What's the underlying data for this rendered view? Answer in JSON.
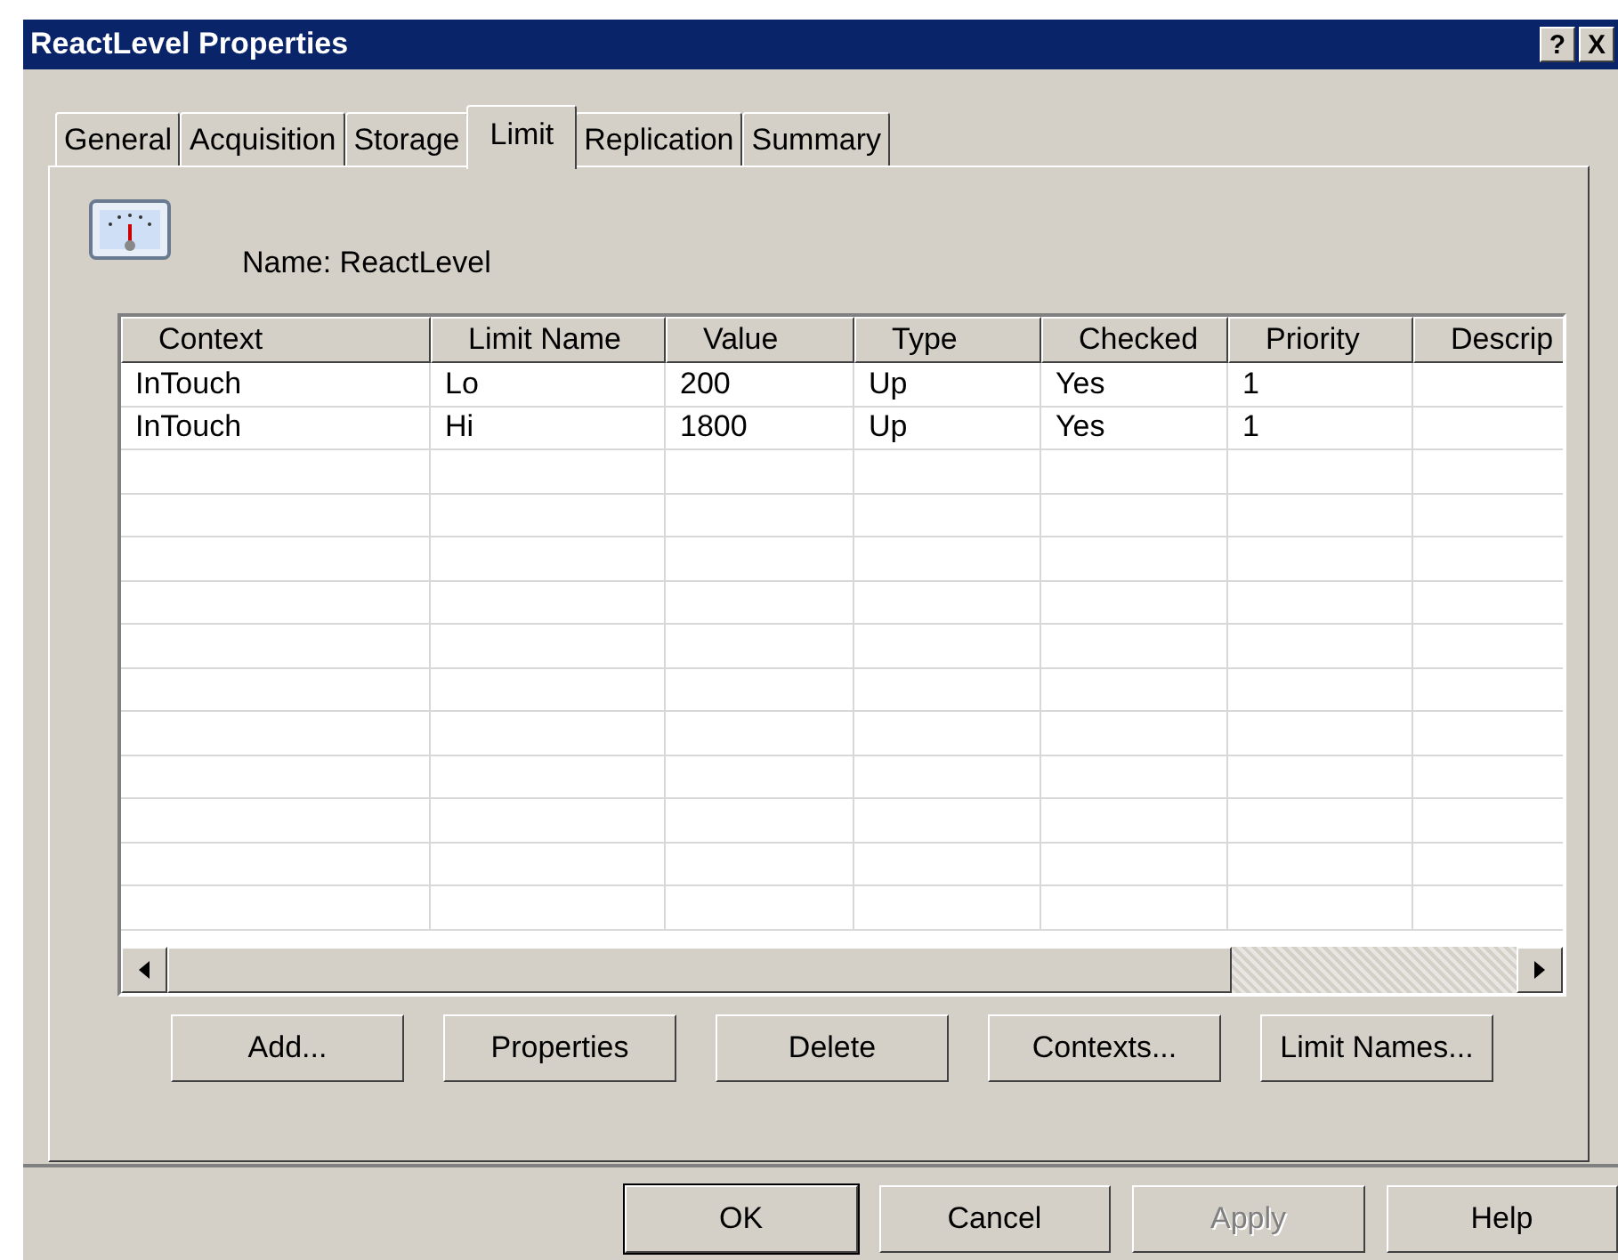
{
  "window": {
    "title": "ReactLevel Properties",
    "title_buttons": [
      "?",
      "X"
    ]
  },
  "tabs": [
    {
      "label": "General",
      "selected": false
    },
    {
      "label": "Acquisition",
      "selected": false
    },
    {
      "label": "Storage",
      "selected": false
    },
    {
      "label": "Limit",
      "selected": true
    },
    {
      "label": "Replication",
      "selected": false
    },
    {
      "label": "Summary",
      "selected": false
    }
  ],
  "name_label": "Name: ReactLevel",
  "table": {
    "columns": [
      "Context",
      "Limit Name",
      "Value",
      "Type",
      "Checked",
      "Priority",
      "Descrip"
    ],
    "rows": [
      [
        "InTouch",
        "Lo",
        "200",
        "Up",
        "Yes",
        "1",
        ""
      ],
      [
        "InTouch",
        "Hi",
        "1800",
        "Up",
        "Yes",
        "1",
        ""
      ]
    ]
  },
  "panel_buttons": [
    "Add...",
    "Properties",
    "Delete",
    "Contexts...",
    "Limit Names..."
  ],
  "dialog_buttons": [
    {
      "label": "OK",
      "default": true,
      "disabled": false
    },
    {
      "label": "Cancel",
      "default": false,
      "disabled": false
    },
    {
      "label": "Apply",
      "default": false,
      "disabled": true
    },
    {
      "label": "Help",
      "default": false,
      "disabled": false
    }
  ]
}
